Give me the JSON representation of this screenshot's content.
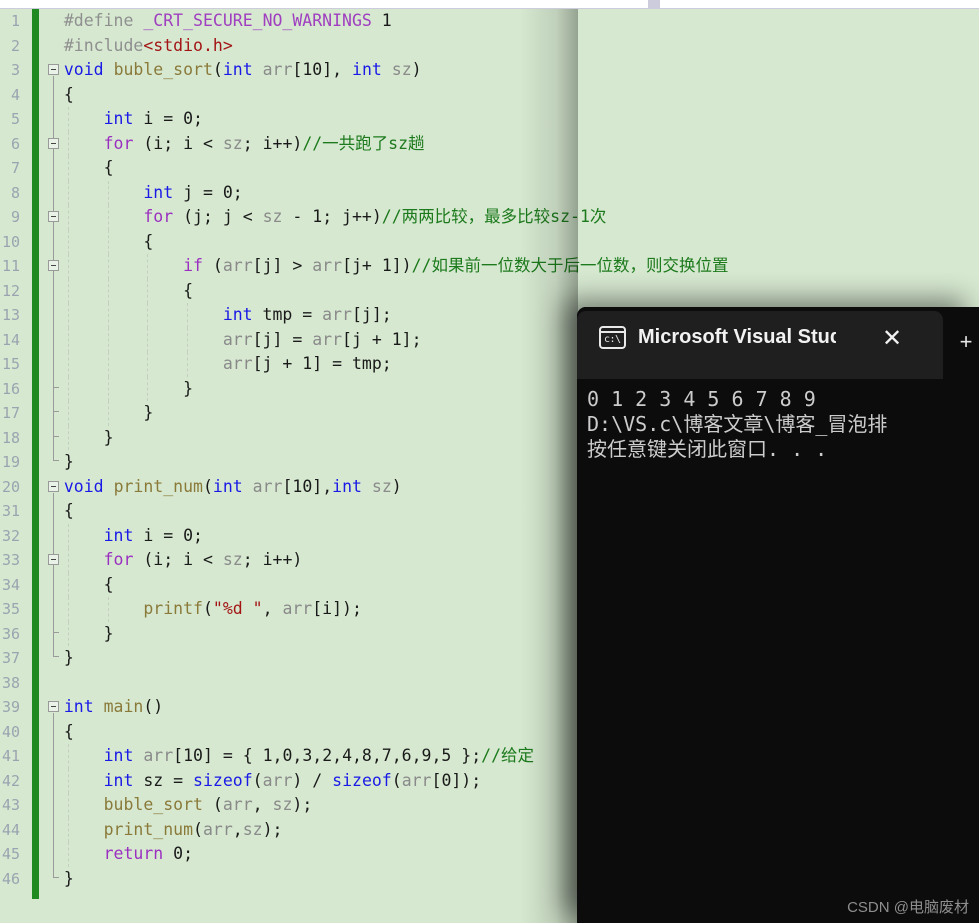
{
  "tabstrip": {
    "left_tab_label": "",
    "right_tab_label": ""
  },
  "editor": {
    "language": "c",
    "line_number_start": 1,
    "current_line": 34,
    "lines": [
      {
        "no": "1",
        "indent": 0,
        "fold": false,
        "tokens": [
          {
            "t": "#define ",
            "c": "pre"
          },
          {
            "t": "_CRT_SECURE_NO_WARNINGS",
            "c": "macro"
          },
          {
            "t": " 1",
            "c": "num"
          }
        ]
      },
      {
        "no": "2",
        "indent": 0,
        "fold": false,
        "tokens": [
          {
            "t": "#include",
            "c": "pre"
          },
          {
            "t": "<stdio.h>",
            "c": "str"
          }
        ]
      },
      {
        "no": "3",
        "indent": 0,
        "fold": true,
        "tokens": [
          {
            "t": "void",
            "c": "kw"
          },
          {
            "t": " ",
            "c": "op"
          },
          {
            "t": "buble_sort",
            "c": "fn"
          },
          {
            "t": "(",
            "c": "op"
          },
          {
            "t": "int",
            "c": "kw"
          },
          {
            "t": " ",
            "c": "op"
          },
          {
            "t": "arr",
            "c": "id"
          },
          {
            "t": "[",
            "c": "op"
          },
          {
            "t": "10",
            "c": "num"
          },
          {
            "t": "], ",
            "c": "op"
          },
          {
            "t": "int",
            "c": "kw"
          },
          {
            "t": " ",
            "c": "op"
          },
          {
            "t": "sz",
            "c": "id"
          },
          {
            "t": ")",
            "c": "op"
          }
        ]
      },
      {
        "no": "4",
        "indent": 0,
        "fold": false,
        "tokens": [
          {
            "t": "{",
            "c": "op"
          }
        ]
      },
      {
        "no": "5",
        "indent": 1,
        "fold": false,
        "tokens": [
          {
            "t": "int",
            "c": "kw"
          },
          {
            "t": " i = ",
            "c": "op"
          },
          {
            "t": "0",
            "c": "num"
          },
          {
            "t": ";",
            "c": "op"
          }
        ]
      },
      {
        "no": "6",
        "indent": 1,
        "fold": true,
        "tokens": [
          {
            "t": "for",
            "c": "ctrl"
          },
          {
            "t": " (i; i < ",
            "c": "op"
          },
          {
            "t": "sz",
            "c": "id"
          },
          {
            "t": "; i++)",
            "c": "op"
          },
          {
            "t": "//一共跑了sz趟",
            "c": "cm"
          }
        ]
      },
      {
        "no": "7",
        "indent": 1,
        "fold": false,
        "tokens": [
          {
            "t": "{",
            "c": "op"
          }
        ]
      },
      {
        "no": "8",
        "indent": 2,
        "fold": false,
        "tokens": [
          {
            "t": "int",
            "c": "kw"
          },
          {
            "t": " j = ",
            "c": "op"
          },
          {
            "t": "0",
            "c": "num"
          },
          {
            "t": ";",
            "c": "op"
          }
        ]
      },
      {
        "no": "9",
        "indent": 2,
        "fold": true,
        "tokens": [
          {
            "t": "for",
            "c": "ctrl"
          },
          {
            "t": " (j; j < ",
            "c": "op"
          },
          {
            "t": "sz",
            "c": "id"
          },
          {
            "t": " - ",
            "c": "op"
          },
          {
            "t": "1",
            "c": "num"
          },
          {
            "t": "; j++)",
            "c": "op"
          },
          {
            "t": "//两两比较，最多比较sz-1次",
            "c": "cm"
          }
        ]
      },
      {
        "no": "10",
        "indent": 2,
        "fold": false,
        "tokens": [
          {
            "t": "{",
            "c": "op"
          }
        ]
      },
      {
        "no": "11",
        "indent": 3,
        "fold": true,
        "tokens": [
          {
            "t": "if",
            "c": "ctrl"
          },
          {
            "t": " (",
            "c": "op"
          },
          {
            "t": "arr",
            "c": "id"
          },
          {
            "t": "[j] > ",
            "c": "op"
          },
          {
            "t": "arr",
            "c": "id"
          },
          {
            "t": "[j+ ",
            "c": "op"
          },
          {
            "t": "1",
            "c": "num"
          },
          {
            "t": "])",
            "c": "op"
          },
          {
            "t": "//如果前一位数大于后一位数，则交换位置",
            "c": "cm"
          }
        ]
      },
      {
        "no": "12",
        "indent": 3,
        "fold": false,
        "tokens": [
          {
            "t": "{",
            "c": "op"
          }
        ]
      },
      {
        "no": "13",
        "indent": 4,
        "fold": false,
        "tokens": [
          {
            "t": "int",
            "c": "kw"
          },
          {
            "t": " tmp = ",
            "c": "op"
          },
          {
            "t": "arr",
            "c": "id"
          },
          {
            "t": "[j];",
            "c": "op"
          }
        ]
      },
      {
        "no": "14",
        "indent": 4,
        "fold": false,
        "tokens": [
          {
            "t": "arr",
            "c": "id"
          },
          {
            "t": "[j] = ",
            "c": "op"
          },
          {
            "t": "arr",
            "c": "id"
          },
          {
            "t": "[j + ",
            "c": "op"
          },
          {
            "t": "1",
            "c": "num"
          },
          {
            "t": "];",
            "c": "op"
          }
        ]
      },
      {
        "no": "15",
        "indent": 4,
        "fold": false,
        "tokens": [
          {
            "t": "arr",
            "c": "id"
          },
          {
            "t": "[j + ",
            "c": "op"
          },
          {
            "t": "1",
            "c": "num"
          },
          {
            "t": "] = tmp;",
            "c": "op"
          }
        ]
      },
      {
        "no": "16",
        "indent": 3,
        "fold": false,
        "tokens": [
          {
            "t": "}",
            "c": "op"
          }
        ]
      },
      {
        "no": "17",
        "indent": 2,
        "fold": false,
        "tokens": [
          {
            "t": "}",
            "c": "op"
          }
        ]
      },
      {
        "no": "18",
        "indent": 1,
        "fold": false,
        "tokens": [
          {
            "t": "}",
            "c": "op"
          }
        ]
      },
      {
        "no": "19",
        "indent": 0,
        "fold": false,
        "tokens": [
          {
            "t": "}",
            "c": "op"
          }
        ]
      },
      {
        "no": "20",
        "indent": 0,
        "fold": true,
        "tokens": [
          {
            "t": "void",
            "c": "kw"
          },
          {
            "t": " ",
            "c": "op"
          },
          {
            "t": "print_num",
            "c": "fn"
          },
          {
            "t": "(",
            "c": "op"
          },
          {
            "t": "int",
            "c": "kw"
          },
          {
            "t": " ",
            "c": "op"
          },
          {
            "t": "arr",
            "c": "id"
          },
          {
            "t": "[",
            "c": "op"
          },
          {
            "t": "10",
            "c": "num"
          },
          {
            "t": "],",
            "c": "op"
          },
          {
            "t": "int",
            "c": "kw"
          },
          {
            "t": " ",
            "c": "op"
          },
          {
            "t": "sz",
            "c": "id"
          },
          {
            "t": ")",
            "c": "op"
          }
        ]
      },
      {
        "no": "31",
        "indent": 0,
        "fold": false,
        "tokens": [
          {
            "t": "{",
            "c": "op"
          }
        ]
      },
      {
        "no": "32",
        "indent": 1,
        "fold": false,
        "tokens": [
          {
            "t": "int",
            "c": "kw"
          },
          {
            "t": " i = ",
            "c": "op"
          },
          {
            "t": "0",
            "c": "num"
          },
          {
            "t": ";",
            "c": "op"
          }
        ]
      },
      {
        "no": "33",
        "indent": 1,
        "fold": true,
        "tokens": [
          {
            "t": "for",
            "c": "ctrl"
          },
          {
            "t": " (i; i < ",
            "c": "op"
          },
          {
            "t": "sz",
            "c": "id"
          },
          {
            "t": "; i++)",
            "c": "op"
          }
        ]
      },
      {
        "no": "34",
        "indent": 1,
        "fold": false,
        "current": true,
        "tokens": [
          {
            "t": "{",
            "c": "op"
          }
        ]
      },
      {
        "no": "35",
        "indent": 2,
        "fold": false,
        "tokens": [
          {
            "t": "printf",
            "c": "fn"
          },
          {
            "t": "(",
            "c": "op"
          },
          {
            "t": "\"%d \"",
            "c": "str"
          },
          {
            "t": ", ",
            "c": "op"
          },
          {
            "t": "arr",
            "c": "id"
          },
          {
            "t": "[i]);",
            "c": "op"
          }
        ]
      },
      {
        "no": "36",
        "indent": 1,
        "fold": false,
        "tokens": [
          {
            "t": "}",
            "c": "op"
          }
        ]
      },
      {
        "no": "37",
        "indent": 0,
        "fold": false,
        "tokens": [
          {
            "t": "}",
            "c": "op"
          }
        ]
      },
      {
        "no": "38",
        "indent": 0,
        "fold": false,
        "tokens": [
          {
            "t": "",
            "c": "op"
          }
        ]
      },
      {
        "no": "39",
        "indent": 0,
        "fold": true,
        "tokens": [
          {
            "t": "int",
            "c": "kw"
          },
          {
            "t": " ",
            "c": "op"
          },
          {
            "t": "main",
            "c": "fn"
          },
          {
            "t": "()",
            "c": "op"
          }
        ]
      },
      {
        "no": "40",
        "indent": 0,
        "fold": false,
        "tokens": [
          {
            "t": "{",
            "c": "op"
          }
        ]
      },
      {
        "no": "41",
        "indent": 1,
        "fold": false,
        "tokens": [
          {
            "t": "int",
            "c": "kw"
          },
          {
            "t": " ",
            "c": "op"
          },
          {
            "t": "arr",
            "c": "id"
          },
          {
            "t": "[",
            "c": "op"
          },
          {
            "t": "10",
            "c": "num"
          },
          {
            "t": "] = { ",
            "c": "op"
          },
          {
            "t": "1,0,3,2,4,8,7,6,9,5",
            "c": "num"
          },
          {
            "t": " };",
            "c": "op"
          },
          {
            "t": "//给定",
            "c": "cm"
          }
        ]
      },
      {
        "no": "42",
        "indent": 1,
        "fold": false,
        "tokens": [
          {
            "t": "int",
            "c": "kw"
          },
          {
            "t": " sz = ",
            "c": "op"
          },
          {
            "t": "sizeof",
            "c": "kw"
          },
          {
            "t": "(",
            "c": "op"
          },
          {
            "t": "arr",
            "c": "id"
          },
          {
            "t": ") / ",
            "c": "op"
          },
          {
            "t": "sizeof",
            "c": "kw"
          },
          {
            "t": "(",
            "c": "op"
          },
          {
            "t": "arr",
            "c": "id"
          },
          {
            "t": "[",
            "c": "op"
          },
          {
            "t": "0",
            "c": "num"
          },
          {
            "t": "]);",
            "c": "op"
          }
        ]
      },
      {
        "no": "43",
        "indent": 1,
        "fold": false,
        "tokens": [
          {
            "t": "buble_sort",
            "c": "fn"
          },
          {
            "t": " (",
            "c": "op"
          },
          {
            "t": "arr",
            "c": "id"
          },
          {
            "t": ", ",
            "c": "op"
          },
          {
            "t": "sz",
            "c": "id"
          },
          {
            "t": ");",
            "c": "op"
          }
        ]
      },
      {
        "no": "44",
        "indent": 1,
        "fold": false,
        "tokens": [
          {
            "t": "print_num",
            "c": "fn"
          },
          {
            "t": "(",
            "c": "op"
          },
          {
            "t": "arr",
            "c": "id"
          },
          {
            "t": ",",
            "c": "op"
          },
          {
            "t": "sz",
            "c": "id"
          },
          {
            "t": ");",
            "c": "op"
          }
        ]
      },
      {
        "no": "45",
        "indent": 1,
        "fold": false,
        "tokens": [
          {
            "t": "return",
            "c": "ctrl"
          },
          {
            "t": " ",
            "c": "op"
          },
          {
            "t": "0",
            "c": "num"
          },
          {
            "t": ";",
            "c": "op"
          }
        ]
      },
      {
        "no": "46",
        "indent": 0,
        "fold": false,
        "tokens": [
          {
            "t": "}",
            "c": "op"
          }
        ]
      }
    ]
  },
  "console": {
    "title": "Microsoft Visual Studio 调试控",
    "icon": "command-prompt-icon",
    "close_label": "✕",
    "new_tab_label": "+",
    "output_lines": [
      "0 1 2 3 4 5 6 7 8 9",
      "D:\\VS.c\\博客文章\\博客_冒泡排",
      "按任意键关闭此窗口. . ."
    ]
  },
  "watermark": {
    "text": "CSDN @电脑废材"
  },
  "colors": {
    "editor_background": "#d6e8d0",
    "console_background": "#0c0c0c",
    "console_titlebar": "#1f1f1f",
    "change_bar": "#1f8a1f",
    "keyword": "#1a1ae6",
    "control": "#9b30c0",
    "function": "#8a7a3a",
    "comment": "#1c7a1c",
    "string": "#a31515",
    "identifier": "#8a8a8a",
    "macro": "#a040c0",
    "current_line": "#e5f0e0"
  }
}
